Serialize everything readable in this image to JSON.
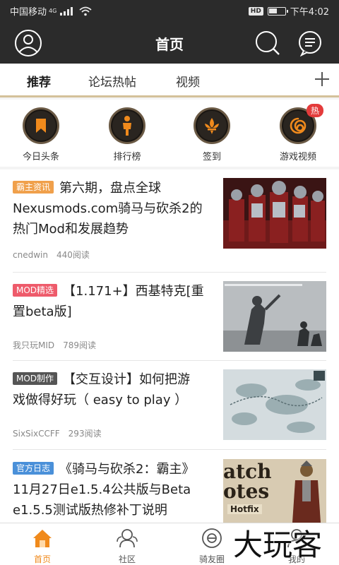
{
  "status_bar": {
    "carrier": "中国移动",
    "network": "4G",
    "hd": "HD",
    "time": "下午4:02",
    "battery_level": 0.55
  },
  "header": {
    "title": "首页"
  },
  "tabs": [
    {
      "label": "推荐",
      "active": true
    },
    {
      "label": "论坛热帖",
      "active": false
    },
    {
      "label": "视频",
      "active": false
    }
  ],
  "quick_links": [
    {
      "label": "今日头条",
      "icon": "bookmark-icon"
    },
    {
      "label": "排行榜",
      "icon": "person-icon"
    },
    {
      "label": "签到",
      "icon": "fleur-de-lis-icon"
    },
    {
      "label": "游戏视频",
      "icon": "swirl-icon",
      "badge": "热"
    }
  ],
  "feed": [
    {
      "tag": "霸主资讯",
      "tag_color": "#f0a04b",
      "title": "第六期，盘点全球Nexusmods.com骑马与砍杀2的热门Mod和发展趋势",
      "title_line1": "第六期，盘点全球",
      "title_line2": "Nexusmods.com骑马与砍杀2的",
      "title_line3": "热门Mod和发展趋势",
      "author": "cnedwin",
      "reads": "440阅读"
    },
    {
      "tag": "MOD精选",
      "tag_color": "#ee5b6b",
      "title_line1": "【1.171+】西基特克[重",
      "title_line2": "置beta版]",
      "author": "我只玩MID",
      "reads": "789阅读"
    },
    {
      "tag": "MOD制作",
      "tag_color": "#555555",
      "title_line1": "【交互设计】如何把游",
      "title_line2": "戏做得好玩（ easy to play ）",
      "author": "SixSixCCFF",
      "reads": "293阅读"
    },
    {
      "tag": "官方日志",
      "tag_color": "#4a90d9",
      "title_line1": "《骑马与砍杀2：霸主》",
      "title_line2": "11月27日e1.5.4公共版与Beta",
      "title_line3": "e1.5.5测试版热修补丁说明",
      "thumb_text_1": "atch",
      "thumb_text_2": "otes",
      "thumb_text_3": "Hotfix"
    }
  ],
  "bottom_nav": [
    {
      "label": "首页",
      "icon": "home-icon",
      "active": true
    },
    {
      "label": "社区",
      "icon": "community-icon",
      "active": false
    },
    {
      "label": "骑友圈",
      "icon": "circle-friends-icon",
      "active": false
    },
    {
      "label": "我的",
      "icon": "profile-icon",
      "active": false
    }
  ],
  "watermark": "大玩客",
  "colors": {
    "header_bg": "#2b2b2b",
    "accent": "#f08a1c",
    "tab_underline": "#d4c19a",
    "hot_badge": "#e43b3b"
  }
}
